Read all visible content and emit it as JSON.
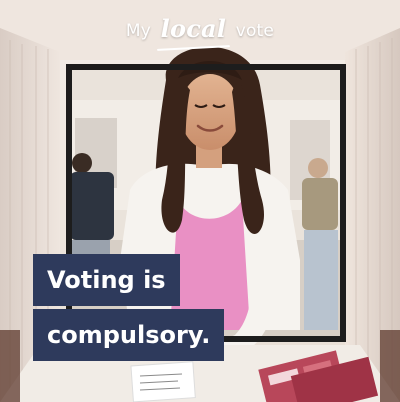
{
  "logo": {
    "prefix": "My",
    "emphasis": "local",
    "suffix": "vote"
  },
  "headline": {
    "line1": "Voting is",
    "line2": "compulsory."
  },
  "colors": {
    "caption_bg": "#2e3a5c",
    "caption_text": "#ffffff",
    "shirt": "#e990c4",
    "frame": "#1d1d1d"
  }
}
